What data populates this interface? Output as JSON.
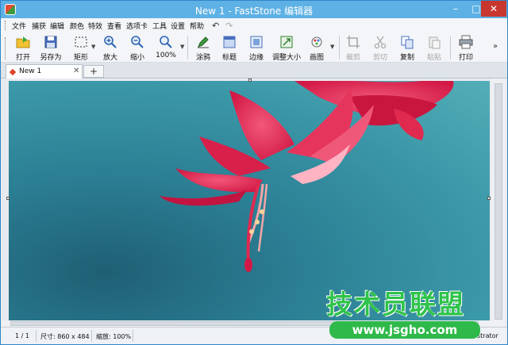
{
  "window": {
    "title": "New 1 - FastStone 编辑器",
    "min": "–",
    "max": "□",
    "close": "✕"
  },
  "menu": {
    "items": [
      "文件",
      "捕获",
      "编辑",
      "颜色",
      "特效",
      "查看",
      "选项卡",
      "工具",
      "设置",
      "帮助"
    ],
    "undo_icon": "undo-icon",
    "redo_icon": "redo-icon"
  },
  "toolbar": {
    "buttons": [
      {
        "id": "open",
        "label": "打开",
        "icon": "open-folder-icon",
        "enabled": true
      },
      {
        "id": "save-as",
        "label": "另存为",
        "icon": "floppy-disk-icon",
        "enabled": true
      },
      {
        "id": "rect",
        "label": "矩形",
        "icon": "selection-rect-icon",
        "enabled": true
      },
      {
        "id": "zoom-in",
        "label": "放大",
        "icon": "zoom-in-icon",
        "enabled": true
      },
      {
        "id": "zoom-out",
        "label": "缩小",
        "icon": "zoom-out-icon",
        "enabled": true
      },
      {
        "id": "zoom-100",
        "label": "100%",
        "icon": "magnifier-icon",
        "enabled": true
      },
      {
        "id": "draw",
        "label": "涂鸦",
        "icon": "draw-icon",
        "enabled": true
      },
      {
        "id": "caption",
        "label": "标题",
        "icon": "caption-icon",
        "enabled": true
      },
      {
        "id": "edge",
        "label": "边缘",
        "icon": "edge-icon",
        "enabled": true
      },
      {
        "id": "resize",
        "label": "调整大小",
        "icon": "resize-icon",
        "enabled": true
      },
      {
        "id": "canvas",
        "label": "画图",
        "icon": "paint-icon",
        "enabled": true
      },
      {
        "id": "crop",
        "label": "裁剪",
        "icon": "crop-icon",
        "enabled": false
      },
      {
        "id": "cut",
        "label": "剪切",
        "icon": "scissors-icon",
        "enabled": false
      },
      {
        "id": "copy",
        "label": "复制",
        "icon": "copy-icon",
        "enabled": true
      },
      {
        "id": "paste",
        "label": "粘贴",
        "icon": "paste-icon",
        "enabled": false
      },
      {
        "id": "print",
        "label": "打印",
        "icon": "printer-icon",
        "enabled": true
      }
    ],
    "overflow": "»"
  },
  "tabs": {
    "items": [
      {
        "label": "New 1",
        "close": "✕"
      }
    ],
    "add": "+"
  },
  "status": {
    "page": "1 / 1",
    "size": "尺寸: 860 x 484",
    "zoom": "缩放: 100%",
    "user": "strator"
  },
  "watermark": {
    "title": "技术员联盟",
    "url": "www.jsgho.com"
  },
  "colors": {
    "titlebar": "#5eb1e4",
    "close_button": "#c7372f",
    "watermark_green": "#2fb94a",
    "photo_teal": "#3b98a8",
    "flower_red": "#e0294f"
  }
}
